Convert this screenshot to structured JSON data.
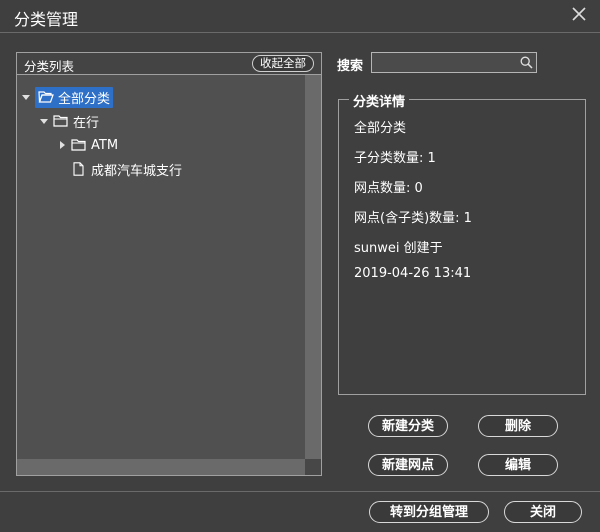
{
  "window": {
    "title": "分类管理",
    "close_icon": "close-icon"
  },
  "category_list": {
    "header": "分类列表",
    "collapse_all": "收起全部",
    "tree": [
      {
        "label": "全部分类",
        "expanded": true,
        "selected": true,
        "icon": "folder-open-icon"
      },
      {
        "label": "在行",
        "expanded": true,
        "selected": false,
        "icon": "folder-icon"
      },
      {
        "label": "ATM",
        "expanded": false,
        "selected": false,
        "icon": "folder-icon"
      },
      {
        "label": "成都汽车城支行",
        "expanded": false,
        "selected": false,
        "icon": "file-icon"
      }
    ]
  },
  "search": {
    "label": "搜索",
    "value": "",
    "placeholder": ""
  },
  "details": {
    "legend": "分类详情",
    "name": "全部分类",
    "subcategory_count": "子分类数量: 1",
    "node_count": "网点数量: 0",
    "node_count_incl": "网点(含子类)数量: 1",
    "creator": "sunwei 创建于",
    "created_at": "2019-04-26 13:41"
  },
  "buttons": {
    "new_category": "新建分类",
    "delete": "删除",
    "new_node": "新建网点",
    "edit": "编辑",
    "goto_group": "转到分组管理",
    "close": "关闭"
  },
  "colors": {
    "background": "#3f3f3f",
    "panel": "#505050",
    "selection": "#2e6fc7",
    "scrollbar": "#6a6a6a"
  }
}
